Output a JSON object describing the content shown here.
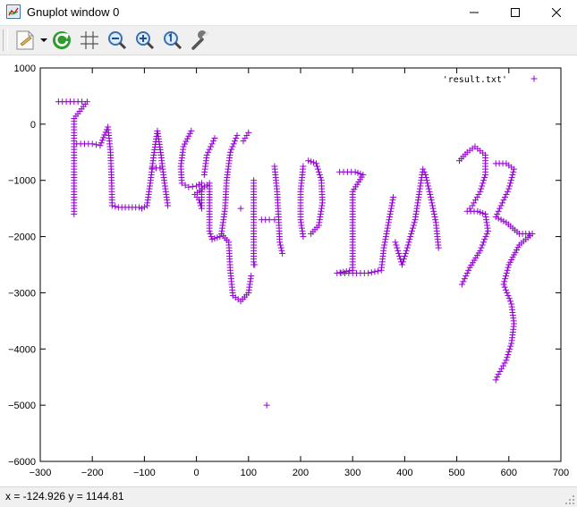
{
  "window": {
    "title": "Gnuplot window 0",
    "icon": "gnuplot-app-icon",
    "controls": [
      "minimize-icon",
      "maximize-icon",
      "close-icon"
    ]
  },
  "toolbar": {
    "buttons": [
      {
        "name": "copy-options-button",
        "icon": "document-menu-icon"
      },
      {
        "name": "replot-button",
        "icon": "refresh-icon"
      },
      {
        "name": "grid-button",
        "icon": "grid-icon"
      },
      {
        "name": "zoom-previous-button",
        "icon": "zoom-out-icon"
      },
      {
        "name": "zoom-next-button",
        "icon": "zoom-in-icon"
      },
      {
        "name": "autoscale-button",
        "icon": "zoom-reset-icon"
      },
      {
        "name": "options-button",
        "icon": "wrench-icon"
      }
    ]
  },
  "status": {
    "text": "x = -124.926 y = 1144.81"
  },
  "colors": {
    "series": "#9400d3",
    "toolbar_bg": "#f0f0f0",
    "refresh": "#2e9b2e"
  },
  "chart_data": {
    "type": "scatter",
    "title": "",
    "xlabel": "",
    "ylabel": "",
    "xlim": [
      -300,
      700
    ],
    "ylim": [
      -6000,
      1000
    ],
    "xticks": [
      -300,
      -200,
      -100,
      0,
      100,
      200,
      300,
      400,
      500,
      600,
      700
    ],
    "yticks": [
      -6000,
      -5000,
      -4000,
      -3000,
      -2000,
      -1000,
      0,
      1000
    ],
    "grid": false,
    "legend_position": "top-right",
    "marker": "+",
    "series": [
      {
        "name": "'result.txt'",
        "points": [
          [
            -265,
            400
          ],
          [
            -250,
            400
          ],
          [
            -235,
            400
          ],
          [
            -220,
            400
          ],
          [
            -210,
            400
          ],
          [
            -235,
            100
          ],
          [
            -235,
            -250
          ],
          [
            -235,
            -600
          ],
          [
            -235,
            -950
          ],
          [
            -235,
            -1300
          ],
          [
            -235,
            -1600
          ],
          [
            -230,
            -350
          ],
          [
            -215,
            -350
          ],
          [
            -200,
            -350
          ],
          [
            -185,
            -380
          ],
          [
            -170,
            -50
          ],
          [
            -165,
            -500
          ],
          [
            -163,
            -1000
          ],
          [
            -162,
            -1450
          ],
          [
            -150,
            -1480
          ],
          [
            -130,
            -1480
          ],
          [
            -110,
            -1480
          ],
          [
            -105,
            -1500
          ],
          [
            -95,
            -1450
          ],
          [
            -88,
            -1000
          ],
          [
            -82,
            -550
          ],
          [
            -75,
            -120
          ],
          [
            -68,
            -550
          ],
          [
            -62,
            -1000
          ],
          [
            -55,
            -1450
          ],
          [
            -85,
            -780
          ],
          [
            -70,
            -780
          ],
          [
            -10,
            -120
          ],
          [
            -25,
            -400
          ],
          [
            -30,
            -750
          ],
          [
            -28,
            -1050
          ],
          [
            -15,
            -1120
          ],
          [
            0,
            -1100
          ],
          [
            10,
            -1050
          ],
          [
            10,
            -1500
          ],
          [
            5,
            -1350
          ],
          [
            -3,
            -1250
          ],
          [
            25,
            -1050
          ],
          [
            25,
            -1450
          ],
          [
            25,
            -1900
          ],
          [
            30,
            -2050
          ],
          [
            45,
            -2000
          ],
          [
            35,
            -250
          ],
          [
            20,
            -550
          ],
          [
            15,
            -900
          ],
          [
            78,
            -200
          ],
          [
            65,
            -500
          ],
          [
            58,
            -1000
          ],
          [
            55,
            -1500
          ],
          [
            48,
            -1950
          ],
          [
            62,
            -2100
          ],
          [
            65,
            -2600
          ],
          [
            70,
            -3050
          ],
          [
            85,
            -3150
          ],
          [
            100,
            -3000
          ],
          [
            105,
            -2700
          ],
          [
            90,
            -300
          ],
          [
            100,
            -150
          ],
          [
            85,
            -1500
          ],
          [
            135,
            -5000
          ],
          [
            110,
            -1000
          ],
          [
            110,
            -1500
          ],
          [
            110,
            -2050
          ],
          [
            110,
            -2500
          ],
          [
            112,
            -2500
          ],
          [
            125,
            -1700
          ],
          [
            140,
            -1700
          ],
          [
            150,
            -1700
          ],
          [
            150,
            -750
          ],
          [
            155,
            -1200
          ],
          [
            158,
            -1700
          ],
          [
            160,
            -2100
          ],
          [
            165,
            -2300
          ],
          [
            205,
            -750
          ],
          [
            200,
            -1200
          ],
          [
            200,
            -1700
          ],
          [
            205,
            -2000
          ],
          [
            215,
            -650
          ],
          [
            230,
            -700
          ],
          [
            240,
            -1000
          ],
          [
            242,
            -1400
          ],
          [
            235,
            -1800
          ],
          [
            220,
            -1950
          ],
          [
            275,
            -850
          ],
          [
            290,
            -850
          ],
          [
            305,
            -850
          ],
          [
            320,
            -900
          ],
          [
            300,
            -1200
          ],
          [
            300,
            -1700
          ],
          [
            300,
            -2200
          ],
          [
            300,
            -2600
          ],
          [
            270,
            -2650
          ],
          [
            285,
            -2650
          ],
          [
            300,
            -2650
          ],
          [
            315,
            -2650
          ],
          [
            330,
            -2650
          ],
          [
            355,
            -2600
          ],
          [
            360,
            -2200
          ],
          [
            370,
            -1700
          ],
          [
            378,
            -1300
          ],
          [
            382,
            -2100
          ],
          [
            395,
            -2500
          ],
          [
            405,
            -2200
          ],
          [
            420,
            -1700
          ],
          [
            430,
            -1100
          ],
          [
            435,
            -800
          ],
          [
            440,
            -900
          ],
          [
            450,
            -1300
          ],
          [
            460,
            -1750
          ],
          [
            465,
            -2200
          ],
          [
            505,
            -650
          ],
          [
            520,
            -500
          ],
          [
            535,
            -400
          ],
          [
            555,
            -550
          ],
          [
            555,
            -900
          ],
          [
            545,
            -1200
          ],
          [
            530,
            -1450
          ],
          [
            520,
            -1550
          ],
          [
            540,
            -1550
          ],
          [
            555,
            -1600
          ],
          [
            560,
            -1900
          ],
          [
            545,
            -2250
          ],
          [
            525,
            -2550
          ],
          [
            510,
            -2850
          ],
          [
            575,
            -700
          ],
          [
            595,
            -700
          ],
          [
            610,
            -800
          ],
          [
            600,
            -1150
          ],
          [
            585,
            -1450
          ],
          [
            575,
            -1650
          ],
          [
            595,
            -1750
          ],
          [
            620,
            -1950
          ],
          [
            645,
            -1950
          ],
          [
            620,
            -2150
          ],
          [
            600,
            -2500
          ],
          [
            590,
            -2850
          ],
          [
            605,
            -3200
          ],
          [
            610,
            -3550
          ],
          [
            605,
            -3900
          ],
          [
            595,
            -4200
          ],
          [
            580,
            -4450
          ],
          [
            575,
            -4550
          ]
        ]
      }
    ]
  }
}
